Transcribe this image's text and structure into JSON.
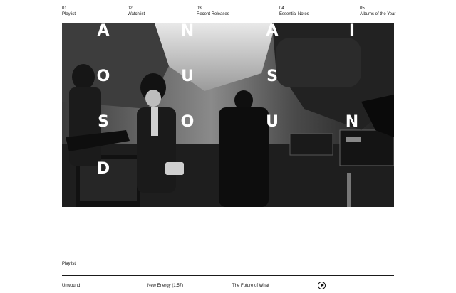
{
  "nav": {
    "items": [
      {
        "number": "01",
        "label": "Playlist"
      },
      {
        "number": "02",
        "label": "Watchlist"
      },
      {
        "number": "03",
        "label": "Recent Releases"
      },
      {
        "number": "04",
        "label": "Essential Notes"
      },
      {
        "number": "05",
        "label": "Albums of the Year"
      }
    ]
  },
  "hero": {
    "letters": [
      "A",
      "N",
      "A",
      "I",
      "O",
      "U",
      "S",
      "S",
      "S",
      "O",
      "U",
      "N",
      "D"
    ]
  },
  "playlist": {
    "title": "Playlist",
    "track": {
      "artist": "Unwound",
      "song": "New Energy (1:57)",
      "album": "The Future of What"
    },
    "play_icon": "play-circle-icon"
  },
  "colors": {
    "background": "#ffffff",
    "text": "#111111"
  }
}
